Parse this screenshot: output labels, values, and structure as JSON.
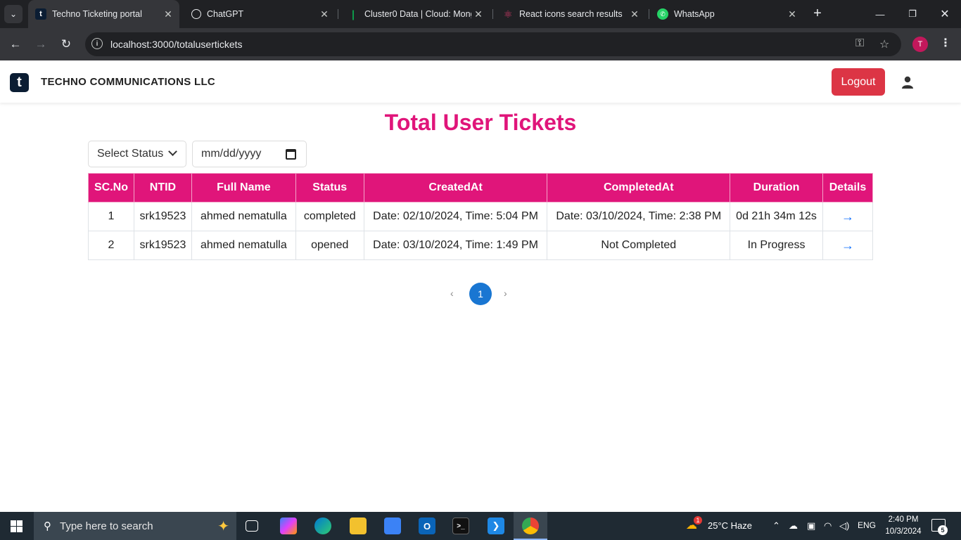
{
  "browser": {
    "tabs": [
      {
        "title": "Techno Ticketing portal",
        "active": true,
        "icon": "t-logo-icon"
      },
      {
        "title": "ChatGPT",
        "active": false,
        "icon": "chatgpt-icon"
      },
      {
        "title": "Cluster0 Data | Cloud: MongoDB",
        "active": false,
        "icon": "mongodb-leaf-icon"
      },
      {
        "title": "React icons search results",
        "active": false,
        "icon": "react-icon"
      },
      {
        "title": "WhatsApp",
        "active": false,
        "icon": "whatsapp-icon"
      }
    ],
    "url": "localhost:3000/totalusertickets",
    "profile_initial": "T"
  },
  "navbar": {
    "logo_letter": "t",
    "brand": "TECHNO COMMUNICATIONS LLC",
    "logout_label": "Logout"
  },
  "page": {
    "title": "Total User Tickets",
    "status_select": "Select Status",
    "date_placeholder": "mm/dd/yyyy"
  },
  "table": {
    "headers": [
      "SC.No",
      "NTID",
      "Full Name",
      "Status",
      "CreatedAt",
      "CompletedAt",
      "Duration",
      "Details"
    ],
    "rows": [
      [
        "1",
        "srk19523",
        "ahmed nematulla",
        "completed",
        "Date: 02/10/2024, Time: 5:04 PM",
        "Date: 03/10/2024, Time: 2:38 PM",
        "0d 21h 34m 12s",
        "→"
      ],
      [
        "2",
        "srk19523",
        "ahmed nematulla",
        "opened",
        "Date: 03/10/2024, Time: 1:49 PM",
        "Not Completed",
        "In Progress",
        "→"
      ]
    ]
  },
  "pagination": {
    "prev": "‹",
    "current": "1",
    "next": "›"
  },
  "taskbar": {
    "search_placeholder": "Type here to search",
    "weather": "25°C  Haze",
    "language": "ENG",
    "time": "2:40 PM",
    "date": "10/3/2024",
    "notification_count": "5",
    "weather_badge": "1"
  },
  "colors": {
    "accent_pink": "#e0157a",
    "logout_red": "#dc3545",
    "pager_blue": "#1976d2",
    "link_blue": "#0d6efd"
  }
}
